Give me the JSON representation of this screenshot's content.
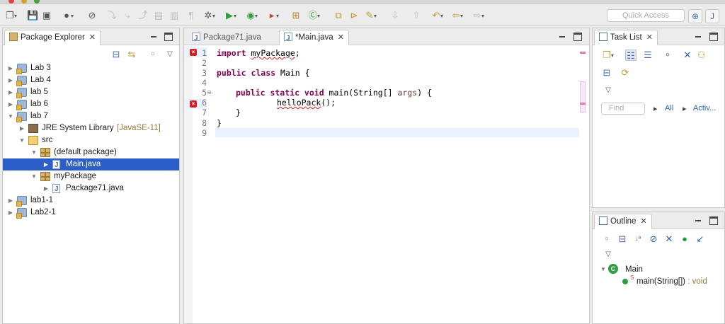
{
  "toolbar": {
    "quick_access_placeholder": "Quick Access"
  },
  "package_explorer": {
    "tab_label": "Package Explorer",
    "tree": [
      {
        "label": "Lab 3",
        "kind": "project",
        "expanded": false
      },
      {
        "label": "Lab 4",
        "kind": "project",
        "expanded": false
      },
      {
        "label": "lab 5",
        "kind": "project",
        "expanded": false
      },
      {
        "label": "lab 6",
        "kind": "project",
        "expanded": false
      },
      {
        "label": "lab 7",
        "kind": "project",
        "expanded": true
      },
      {
        "label": "JRE System Library",
        "decoration": "[JavaSE-11]",
        "kind": "library"
      },
      {
        "label": "src",
        "kind": "source-folder"
      },
      {
        "label": "(default package)",
        "kind": "package"
      },
      {
        "label": "Main.java",
        "kind": "java-file",
        "selected": true
      },
      {
        "label": "myPackage",
        "kind": "package"
      },
      {
        "label": "Package71.java",
        "kind": "java-file"
      },
      {
        "label": "lab1-1",
        "kind": "project",
        "expanded": false
      },
      {
        "label": "Lab2-1",
        "kind": "project",
        "expanded": false
      }
    ]
  },
  "editor": {
    "tabs": [
      {
        "label": "Package71.java",
        "active": false
      },
      {
        "label": "*Main.java",
        "active": true
      }
    ],
    "line_numbers": [
      "1",
      "2",
      "3",
      "4",
      "5",
      "6",
      "7",
      "8",
      "9"
    ],
    "lines": {
      "l1_kw": "import",
      "l1_pkg": "myPackage",
      "l1_end": ";",
      "l3_kw": "public class",
      "l3_rest": " Main {",
      "l5_kw1": "public static void",
      "l5_rest1": " main(String[] ",
      "l5_args": "args",
      "l5_rest2": ") {",
      "l6_call": "helloPack",
      "l6_end": "();",
      "l7": "}",
      "l8": "}"
    }
  },
  "task_list": {
    "tab_label": "Task List",
    "find_placeholder": "Find",
    "all_label": "All",
    "activate_label": "Activ..."
  },
  "outline": {
    "tab_label": "Outline",
    "class_label": "Main",
    "method_label": "main(String[])",
    "method_return": " : void"
  },
  "colors": {
    "keyword": "#7f0055",
    "selection": "#2b5ec7",
    "error": "#d62020"
  }
}
